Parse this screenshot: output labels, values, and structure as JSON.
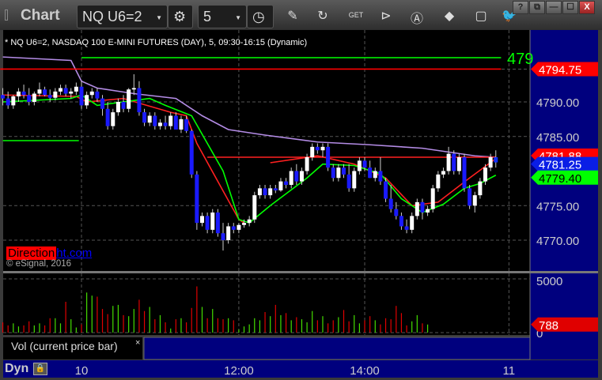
{
  "window": {
    "title": "Chart",
    "buttons": [
      "?",
      "⧉",
      "—",
      "☐",
      "X"
    ]
  },
  "toolbar": {
    "symbol": "NQ U6=2",
    "interval": "5",
    "icons": [
      "pencil-icon",
      "cursor-refresh-icon",
      "get-icon",
      "play-icon",
      "alert-icon",
      "link-icon",
      "comment-icon",
      "twitter-icon"
    ]
  },
  "chart": {
    "description": "* NQ U6=2, NASDAQ 100 E-MINI FUTURES (DAY), 5, 09:30-16:15 (Dynamic)",
    "brand_left": "Direction",
    "brand_right": "ht.com",
    "copyright": "© eSignal, 2016",
    "volume_label": "Vol (current price bar)",
    "close_label": "×",
    "dyn_label": "Dyn",
    "price_labels": [
      {
        "text": "4794.75",
        "bg": "#ff0000",
        "fg": "#ffffff",
        "price": 4794.75
      },
      {
        "text": "4781.88",
        "bg": "#ff0000",
        "fg": "#ffffff",
        "price": 4781.88
      },
      {
        "text": "4781.25",
        "bg": "#0a1ee6",
        "fg": "#ffffff",
        "price": 4781.25
      },
      {
        "text": "4779.40",
        "bg": "#00ff00",
        "fg": "#000000",
        "price": 4779.4
      }
    ],
    "volume_value_label": {
      "text": "788",
      "bg": "#e00000",
      "fg": "#ffffff",
      "value": 788
    },
    "cut_label": "479"
  },
  "chart_data": {
    "type": "candlestick",
    "y_ticks": [
      "4790.00",
      "4785.00",
      "4775.00",
      "4770.00"
    ],
    "y_tick_values": [
      4790,
      4785,
      4775,
      4770
    ],
    "ylim": [
      4767,
      4800
    ],
    "x_ticks": [
      {
        "label": "10",
        "bar": 0
      },
      {
        "label": "12:00",
        "bar": 30
      },
      {
        "label": "14:00",
        "bar": 54
      },
      {
        "label": "11",
        "bar": 81.5
      }
    ],
    "volume_ticks": [
      "5000",
      "0"
    ],
    "volume_ylim": [
      0,
      5000
    ],
    "grid": true,
    "bars_start": -15,
    "ohlc": [
      [
        4791,
        4792,
        4789.5,
        4790.5
      ],
      [
        4790.5,
        4791.5,
        4789,
        4789.5
      ],
      [
        4789.5,
        4791,
        4789,
        4790.8
      ],
      [
        4790.8,
        4792,
        4790,
        4791.5
      ],
      [
        4791.5,
        4792.5,
        4790.5,
        4791
      ],
      [
        4791,
        4792,
        4789.5,
        4790
      ],
      [
        4790,
        4791.5,
        4789.5,
        4791.2
      ],
      [
        4791.2,
        4792.8,
        4790.8,
        4791.8
      ],
      [
        4791.8,
        4792.2,
        4790.8,
        4791
      ],
      [
        4791,
        4791.8,
        4790,
        4790.6
      ],
      [
        4790.6,
        4792,
        4790.2,
        4791.5
      ],
      [
        4791.5,
        4792.5,
        4791,
        4792
      ],
      [
        4792,
        4792.5,
        4790.8,
        4791.2
      ],
      [
        4791.2,
        4792,
        4790.5,
        4791.5
      ],
      [
        4791.5,
        4792.8,
        4791,
        4792.2
      ],
      [
        4792.2,
        4793,
        4789,
        4789.5
      ],
      [
        4789.5,
        4791.5,
        4789,
        4791
      ],
      [
        4791,
        4792,
        4790.5,
        4791.5
      ],
      [
        4791.5,
        4792,
        4790,
        4790.5
      ],
      [
        4790.5,
        4791,
        4788,
        4789
      ],
      [
        4789,
        4790,
        4786,
        4786.5
      ],
      [
        4786.5,
        4789,
        4786,
        4788.5
      ],
      [
        4788.5,
        4790.5,
        4788,
        4790
      ],
      [
        4790,
        4791,
        4788.5,
        4789
      ],
      [
        4789,
        4792,
        4788.5,
        4791.8
      ],
      [
        4791.8,
        4794,
        4791,
        4792
      ],
      [
        4792,
        4793,
        4788,
        4788.5
      ],
      [
        4788.5,
        4789,
        4786.5,
        4787
      ],
      [
        4787,
        4788.5,
        4786.5,
        4788
      ],
      [
        4788,
        4788.5,
        4786,
        4786.5
      ],
      [
        4786.5,
        4787.5,
        4786,
        4787
      ],
      [
        4787,
        4788,
        4786,
        4786.5
      ],
      [
        4786.5,
        4788.5,
        4786,
        4788
      ],
      [
        4788,
        4788.5,
        4786,
        4786
      ],
      [
        4786,
        4788,
        4785.5,
        4787.5
      ],
      [
        4787.5,
        4788,
        4785.5,
        4785.8
      ],
      [
        4785.8,
        4786,
        4779,
        4779.5
      ],
      [
        4779.5,
        4780,
        4771.5,
        4772.5
      ],
      [
        4772.5,
        4774,
        4772,
        4773.5
      ],
      [
        4773.5,
        4774,
        4771,
        4771.5
      ],
      [
        4771.5,
        4774.5,
        4771,
        4774
      ],
      [
        4774,
        4774.5,
        4770.5,
        4771
      ],
      [
        4771,
        4772.5,
        4768.5,
        4770
      ],
      [
        4770,
        4772.5,
        4769.5,
        4772
      ],
      [
        4772,
        4772.5,
        4771,
        4771.5
      ],
      [
        4771.5,
        4772.5,
        4771,
        4772.2
      ],
      [
        4772.2,
        4773,
        4771.8,
        4772.5
      ],
      [
        4772.5,
        4773.5,
        4772,
        4773
      ],
      [
        4773,
        4777,
        4772.5,
        4776.5
      ],
      [
        4776.5,
        4778,
        4776,
        4777.5
      ],
      [
        4777.5,
        4778,
        4776,
        4776.5
      ],
      [
        4776.5,
        4778,
        4776,
        4777.5
      ],
      [
        4777.5,
        4778,
        4776.8,
        4777.2
      ],
      [
        4777.2,
        4779,
        4777,
        4778.5
      ],
      [
        4778.5,
        4779,
        4777.5,
        4778
      ],
      [
        4778,
        4780.5,
        4777.5,
        4780
      ],
      [
        4780,
        4781,
        4778,
        4778.5
      ],
      [
        4778.5,
        4780.5,
        4778,
        4780
      ],
      [
        4780,
        4782.5,
        4779.5,
        4782
      ],
      [
        4782,
        4784,
        4781.5,
        4783.5
      ],
      [
        4783.5,
        4784,
        4782.5,
        4783
      ],
      [
        4783,
        4784,
        4782,
        4783.5
      ],
      [
        4783.5,
        4784,
        4780,
        4780.5
      ],
      [
        4780.5,
        4781,
        4778.5,
        4779
      ],
      [
        4779,
        4781,
        4778.5,
        4780.5
      ],
      [
        4780.5,
        4781,
        4779,
        4779.5
      ],
      [
        4779.5,
        4781,
        4777,
        4777.5
      ],
      [
        4777.5,
        4780.5,
        4777,
        4780
      ],
      [
        4780,
        4782,
        4779.5,
        4781.5
      ],
      [
        4781.5,
        4782,
        4780,
        4780.5
      ],
      [
        4780.5,
        4781.5,
        4779,
        4779
      ],
      [
        4779,
        4780.5,
        4778.5,
        4780
      ],
      [
        4780,
        4782,
        4778,
        4778.5
      ],
      [
        4778.5,
        4779,
        4775.5,
        4776
      ],
      [
        4776,
        4778,
        4774,
        4774.5
      ],
      [
        4774.5,
        4775.5,
        4773,
        4773.5
      ],
      [
        4773.5,
        4774,
        4771.5,
        4772
      ],
      [
        4772,
        4773,
        4771,
        4771.5
      ],
      [
        4771.5,
        4774,
        4771,
        4773.5
      ],
      [
        4773.5,
        4776,
        4773,
        4775.5
      ],
      [
        4775.5,
        4776,
        4773,
        4774
      ],
      [
        4774,
        4775,
        4773.5,
        4774.5
      ],
      [
        4774.5,
        4778,
        4774,
        4777.5
      ],
      [
        4777.5,
        4780,
        4777,
        4779.5
      ],
      [
        4779.5,
        4780.5,
        4779,
        4780
      ],
      [
        4780,
        4783.5,
        4779.5,
        4782.5
      ],
      [
        4782.5,
        4783,
        4779.5,
        4780
      ],
      [
        4780,
        4782.5,
        4779.5,
        4782
      ],
      [
        4782,
        4782.5,
        4777,
        4777.5
      ],
      [
        4777.5,
        4778,
        4774.5,
        4775
      ],
      [
        4775,
        4777,
        4774,
        4776.5
      ],
      [
        4776.5,
        4779,
        4776,
        4778.5
      ],
      [
        4778.5,
        4781,
        4778,
        4780.5
      ],
      [
        4780.5,
        4782.5,
        4780,
        4782
      ],
      [
        4782,
        4783,
        4780.5,
        4781.25
      ]
    ],
    "volume": [
      1000,
      700,
      900,
      600,
      700,
      1100,
      700,
      900,
      700,
      1400,
      1400,
      900,
      3000,
      1300,
      500,
      800,
      3900,
      3600,
      3500,
      2300,
      1800,
      2600,
      2700,
      1700,
      1600,
      2300,
      3200,
      2100,
      2500,
      1300,
      1700,
      1000,
      400,
      1300,
      1400,
      1000,
      2400,
      4500,
      2500,
      1400,
      2300,
      1400,
      1300,
      1400,
      1200,
      300,
      600,
      800,
      1400,
      1200,
      2000,
      1600,
      2700,
      1700,
      1900,
      1200,
      1500,
      1300,
      1000,
      2100,
      1200,
      1600,
      900,
      1200,
      1500,
      2200,
      1100,
      1700,
      900,
      1200,
      1600,
      1200,
      800,
      1400,
      1300,
      2600,
      1900,
      700,
      1100,
      1700,
      900,
      788
    ],
    "lines": [
      {
        "color": "#b48ce6",
        "points": [
          [
            -15,
            4796.5
          ],
          [
            -2,
            4796
          ],
          [
            0,
            4793
          ],
          [
            3,
            4792
          ],
          [
            10,
            4791.2
          ],
          [
            18,
            4790.5
          ],
          [
            23,
            4788
          ],
          [
            28,
            4786
          ],
          [
            35,
            4785.2
          ],
          [
            45,
            4784.2
          ],
          [
            55,
            4783.8
          ],
          [
            65,
            4783.3
          ],
          [
            75,
            4782.2
          ],
          [
            79,
            4782
          ]
        ]
      },
      {
        "color": "#ff2020",
        "points": [
          [
            -15,
            4791
          ],
          [
            -1,
            4790.8
          ],
          [
            1,
            4790
          ],
          [
            8,
            4790.5
          ],
          [
            12,
            4789.6
          ],
          [
            17,
            4788.5
          ],
          [
            20,
            4788
          ],
          [
            22,
            4784
          ],
          [
            30,
            4773
          ],
          [
            31,
            4772.5
          ]
        ]
      },
      {
        "color": "#ff2020",
        "points": [
          [
            24,
            4782
          ],
          [
            79,
            4782
          ]
        ]
      },
      {
        "color": "#ff2020",
        "points": [
          [
            36,
            4781.2
          ],
          [
            45,
            4782.2
          ],
          [
            52,
            4781
          ],
          [
            58,
            4779
          ],
          [
            63,
            4775
          ],
          [
            68,
            4775.5
          ],
          [
            74,
            4779
          ],
          [
            79,
            4781.8
          ]
        ]
      },
      {
        "color": "#00ff00",
        "points": [
          [
            -15,
            4790
          ],
          [
            -2,
            4790.5
          ],
          [
            0,
            4791
          ],
          [
            3,
            4789.5
          ],
          [
            8,
            4790
          ],
          [
            13,
            4790.5
          ],
          [
            16,
            4789.5
          ],
          [
            21,
            4788
          ],
          [
            27,
            4780
          ],
          [
            30,
            4773
          ],
          [
            32,
            4772.5
          ],
          [
            36,
            4775
          ],
          [
            43,
            4779
          ],
          [
            46,
            4781
          ],
          [
            52,
            4780.8
          ],
          [
            57,
            4779.6
          ],
          [
            61,
            4776
          ],
          [
            65,
            4774
          ],
          [
            69,
            4775.2
          ],
          [
            73,
            4777.5
          ],
          [
            76,
            4778.2
          ],
          [
            79,
            4779.4
          ]
        ]
      },
      {
        "color": "#00ff00",
        "points": [
          [
            -15,
            4784.4
          ],
          [
            -0.5,
            4784.4
          ]
        ]
      },
      {
        "color": "#00ff00",
        "points": [
          [
            0,
            4796.4
          ],
          [
            80,
            4796.4
          ]
        ]
      },
      {
        "color": "#ff0000",
        "points": [
          [
            -15.5,
            4794.75
          ],
          [
            80,
            4794.75
          ]
        ]
      }
    ]
  }
}
